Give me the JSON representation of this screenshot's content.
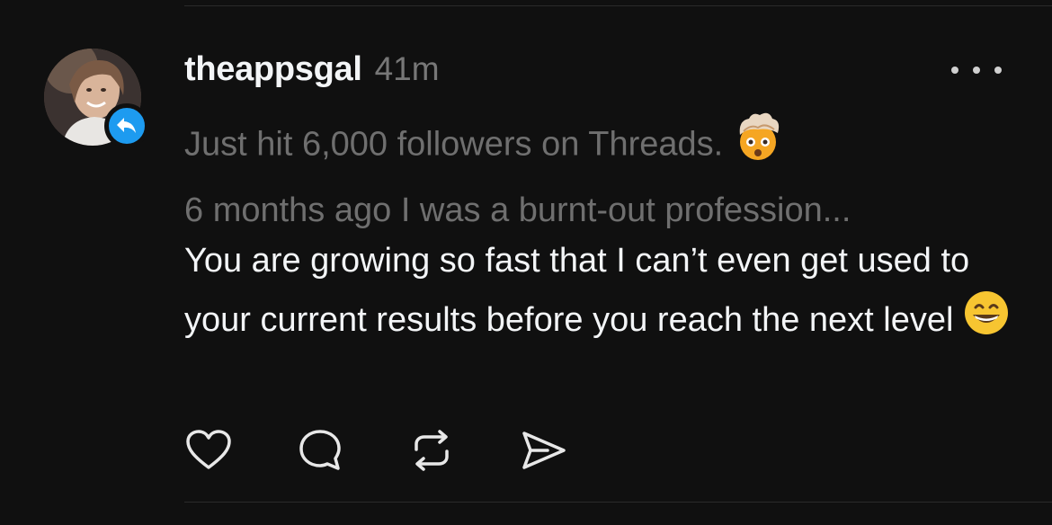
{
  "post": {
    "username": "theappsgal",
    "timestamp": "41m",
    "quoted_line_1": "Just hit 6,000 followers on Threads.",
    "quoted_line_1_emoji": "exploding-head-emoji",
    "quoted_line_2": "6 months ago I was a burnt-out profession...",
    "reply_text": "You are growing so fast that I can’t even get used to your current results before you reach the next level",
    "reply_emoji": "grinning-face-emoji"
  },
  "icons": {
    "more": "more-options-icon",
    "reply_badge": "reply-arrow-icon",
    "like": "heart-icon",
    "comment": "comment-bubble-icon",
    "repost": "repost-icon",
    "share": "send-icon"
  },
  "colors": {
    "background": "#101010",
    "primary_text": "#f3f5f7",
    "secondary_text": "#777777",
    "reply_badge": "#1d9bf0"
  }
}
